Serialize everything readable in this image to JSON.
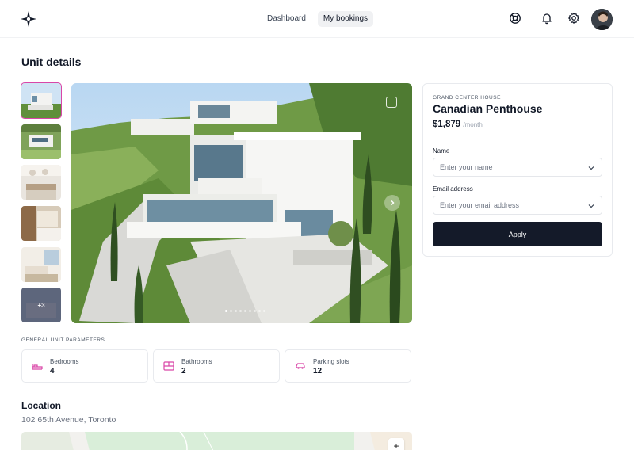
{
  "header": {
    "logo_icon": "sparkle-logo-icon",
    "nav": [
      {
        "label": "Dashboard",
        "active": false
      },
      {
        "label": "My bookings",
        "active": true
      }
    ],
    "icons": [
      "support-icon",
      "bell-icon",
      "gear-icon"
    ],
    "avatar": "user-avatar"
  },
  "page": {
    "title": "Unit details"
  },
  "gallery": {
    "more_count": "+3",
    "total_dots": 9,
    "active_dot": 0,
    "next_icon": "chevron-right-icon",
    "expand_icon": "expand-icon"
  },
  "parameters": {
    "caption": "GENERAL UNIT PARAMETERS",
    "items": [
      {
        "label": "Bedrooms",
        "value": "4",
        "icon": "bed-icon"
      },
      {
        "label": "Bathrooms",
        "value": "2",
        "icon": "bathtub-icon"
      },
      {
        "label": "Parking slots",
        "value": "12",
        "icon": "car-icon"
      }
    ]
  },
  "location": {
    "title": "Location",
    "address": "102 65th Avenue, Toronto",
    "zoom_in": "+"
  },
  "booking": {
    "eyebrow": "GRAND CENTER HOUSE",
    "name": "Canadian Penthouse",
    "price": "$1,879",
    "price_unit": "/month",
    "name_label": "Name",
    "name_placeholder": "Enter your name",
    "email_label": "Email address",
    "email_placeholder": "Enter your email address",
    "apply_label": "Apply"
  },
  "colors": {
    "accent_pink": "#d946a8",
    "button_dark": "#141a29"
  }
}
